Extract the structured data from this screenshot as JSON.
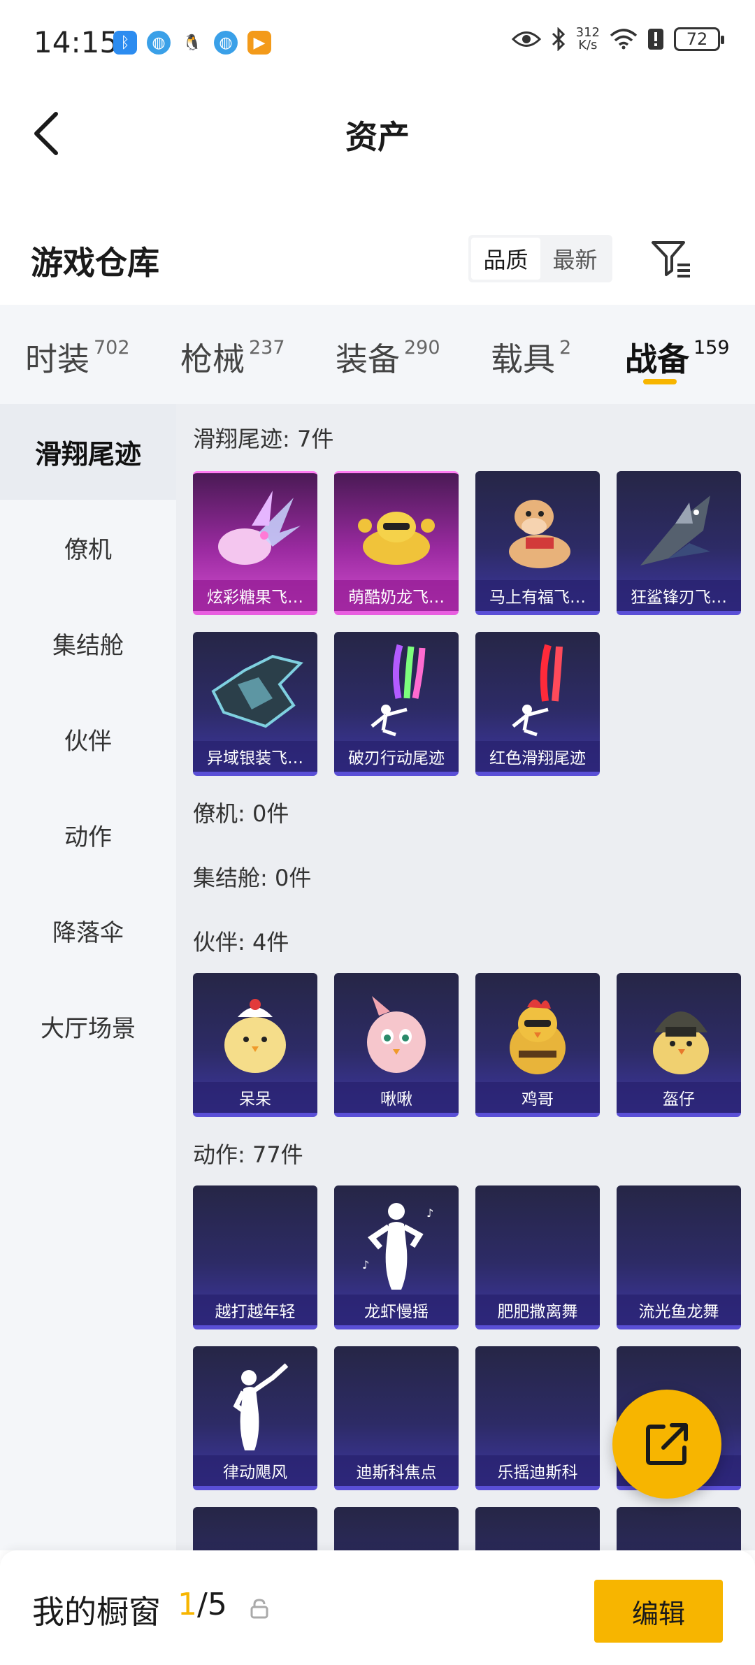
{
  "status_bar": {
    "time": "14:15",
    "net_speed_value": "312",
    "net_speed_unit": "K/s",
    "battery": "72",
    "icons": [
      "bluetooth-app-icon",
      "browser-icon",
      "qq-penguin-icon",
      "browser-icon",
      "video-app-icon",
      "eye-icon",
      "bluetooth-icon",
      "wifi-icon",
      "alert-icon",
      "battery-icon"
    ]
  },
  "header": {
    "title": "资产"
  },
  "section": {
    "title": "游戏仓库",
    "sort_options": [
      "品质",
      "最新"
    ],
    "active_sort": "品质"
  },
  "tabs": [
    {
      "label": "时装",
      "count": "702"
    },
    {
      "label": "枪械",
      "count": "237"
    },
    {
      "label": "装备",
      "count": "290"
    },
    {
      "label": "载具",
      "count": "2"
    },
    {
      "label": "战备",
      "count": "159",
      "active": true
    }
  ],
  "sidebar": [
    {
      "label": "滑翔尾迹",
      "active": true
    },
    {
      "label": "僚机"
    },
    {
      "label": "集结舱"
    },
    {
      "label": "伙伴"
    },
    {
      "label": "动作"
    },
    {
      "label": "降落伞"
    },
    {
      "label": "大厅场景"
    }
  ],
  "groups": [
    {
      "title": "滑翔尾迹: 7件",
      "items": [
        {
          "name": "炫彩糖果飞…",
          "rarity": "pink"
        },
        {
          "name": "萌酷奶龙飞…",
          "rarity": "pink"
        },
        {
          "name": "马上有福飞…",
          "rarity": "purple"
        },
        {
          "name": "狂鲨锋刃飞…",
          "rarity": "purple"
        },
        {
          "name": "异域银装飞…",
          "rarity": "purple"
        },
        {
          "name": "破刃行动尾迹",
          "rarity": "purple"
        },
        {
          "name": "红色滑翔尾迹",
          "rarity": "purple"
        }
      ]
    },
    {
      "title": "僚机: 0件",
      "items": []
    },
    {
      "title": "集结舱: 0件",
      "items": []
    },
    {
      "title": "伙伴: 4件",
      "items": [
        {
          "name": "呆呆",
          "rarity": "purple"
        },
        {
          "name": "啾啾",
          "rarity": "purple"
        },
        {
          "name": "鸡哥",
          "rarity": "purple"
        },
        {
          "name": "盔仔",
          "rarity": "purple"
        }
      ]
    },
    {
      "title": "动作: 77件",
      "items": [
        {
          "name": "越打越年轻",
          "rarity": "purple"
        },
        {
          "name": "龙虾慢摇",
          "rarity": "purple"
        },
        {
          "name": "肥肥撒离舞",
          "rarity": "purple"
        },
        {
          "name": "流光鱼龙舞",
          "rarity": "purple"
        },
        {
          "name": "律动飓风",
          "rarity": "purple"
        },
        {
          "name": "迪斯科焦点",
          "rarity": "purple"
        },
        {
          "name": "乐摇迪斯科",
          "rarity": "purple"
        },
        {
          "name": "",
          "rarity": "purple"
        },
        {
          "name": "",
          "rarity": "purple"
        },
        {
          "name": "",
          "rarity": "purple"
        },
        {
          "name": "",
          "rarity": "purple"
        },
        {
          "name": "",
          "rarity": "purple"
        }
      ]
    }
  ],
  "bottom_bar": {
    "title": "我的橱窗",
    "current": "1",
    "total": "/5",
    "edit_label": "编辑"
  },
  "colors": {
    "accent": "#f7b500",
    "card_purple": "#3e37a2",
    "card_pink": "#d24ecf"
  }
}
